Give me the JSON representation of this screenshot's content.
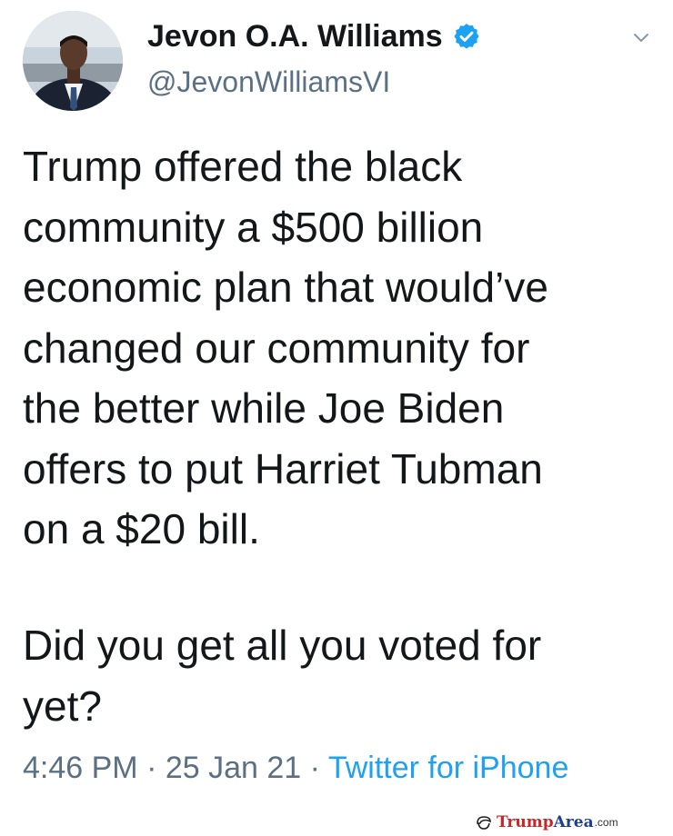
{
  "author": {
    "display_name": "Jevon O.A. Williams",
    "handle": "@JevonWilliamsVI",
    "verified": true,
    "avatar_icon": "profile-photo"
  },
  "tweet": {
    "paragraph1_lines": "Trump offered the black\ncommunity a $500 billion\neconomic plan that would’ve\nchanged our community for\nthe better while Joe Biden\noffers to put Harriet Tubman\non a $20 bill.",
    "paragraph2_lines": "Did you get all you voted for\nyet?"
  },
  "meta": {
    "time": "4:46 PM",
    "separator": " · ",
    "date": "25 Jan 21",
    "source": "Twitter for iPhone"
  },
  "watermark": {
    "part1": "Trump",
    "part2": "Area",
    "part3": ".com"
  },
  "colors": {
    "text": "#14171a",
    "secondary": "#5b7083",
    "link": "#1da1f2",
    "verified": "#1da1f2"
  }
}
